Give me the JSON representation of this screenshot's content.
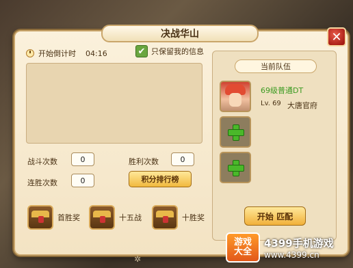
{
  "dialog": {
    "title": "决战华山",
    "close_label": "✕"
  },
  "timer": {
    "label": "开始倒计时",
    "value": "04:16"
  },
  "filter": {
    "checked": true,
    "check_glyph": "✔",
    "label": "只保留我的信息"
  },
  "stats": {
    "battles_label": "战斗次数",
    "battles_value": "0",
    "wins_label": "胜利次数",
    "wins_value": "0",
    "streak_label": "连胜次数",
    "streak_value": "0"
  },
  "ranking_button": "积分排行榜",
  "rewards": [
    {
      "label": "首胜奖",
      "icon": "treasure-chest-icon"
    },
    {
      "label": "十五战",
      "icon": "treasure-chest-icon"
    },
    {
      "label": "十胜奖",
      "icon": "treasure-chest-icon"
    }
  ],
  "team": {
    "header": "当前队伍",
    "member": {
      "name": "69级普通DT",
      "level": "Lv. 69",
      "sect": "大唐官府"
    },
    "empty_slots": 2
  },
  "match_button": "开始 匹配",
  "watermark": {
    "logo_line1": "游戏",
    "logo_line2": "大全",
    "title": "4399手机游戏",
    "url": "www.4399.cn"
  },
  "colors": {
    "panel": "#f3e3c3",
    "border": "#c9a56a",
    "green_name": "#3a9a20",
    "button_gold": "#f1b93e",
    "close_red": "#a61c14"
  }
}
